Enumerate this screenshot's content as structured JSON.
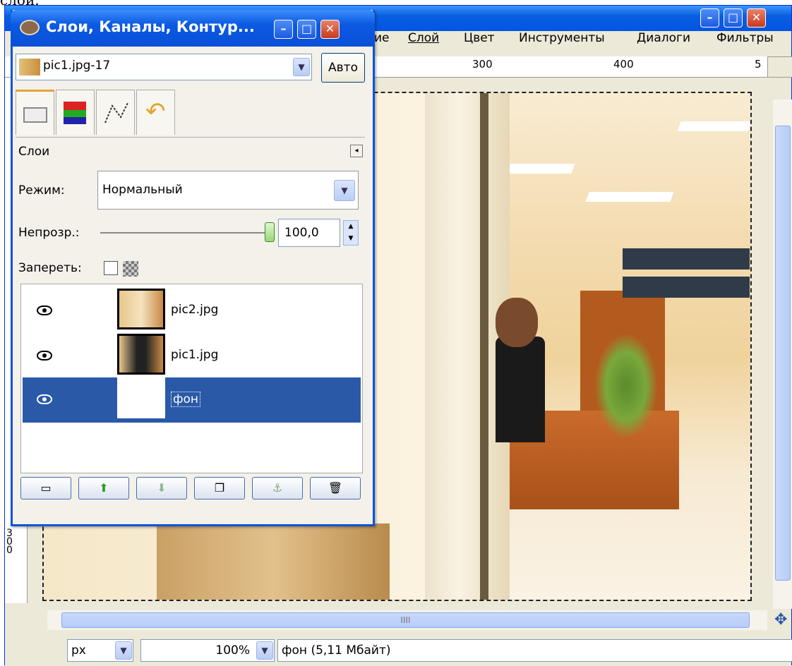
{
  "caption": "слой.",
  "main": {
    "menu": [
      "ие",
      "Слой",
      "Цвет",
      "Инструменты",
      "Диалоги",
      "Фильтры"
    ],
    "ruler_labels": [
      "300",
      "400",
      "5"
    ],
    "left_ruler_label": "300",
    "status": {
      "unit": "px",
      "zoom": "100%",
      "info": "фон (5,11 Мбайт)"
    },
    "scroll_mark": "IIII"
  },
  "dialog": {
    "title": "Слои, Каналы, Контур...",
    "image_selector": "pic1.jpg-17",
    "auto_label": "Авто",
    "tabs": [
      "layers-tab-icon",
      "channels-tab-icon",
      "paths-tab-icon",
      "undo-tab-icon"
    ],
    "panel_title": "Слои",
    "mode_label": "Режим:",
    "mode_value": "Нормальный",
    "opacity_label": "Непрозр.:",
    "opacity_value": "100,0",
    "opacity_fraction": 1.0,
    "lock_label": "Запереть:",
    "layers": [
      {
        "name": "pic2.jpg",
        "visible": true,
        "selected": false
      },
      {
        "name": "pic1.jpg",
        "visible": true,
        "selected": false
      },
      {
        "name": "фон",
        "visible": true,
        "selected": true
      }
    ],
    "buttons": [
      "new-layer-icon",
      "raise-layer-icon",
      "lower-layer-icon",
      "duplicate-layer-icon",
      "anchor-layer-icon",
      "delete-layer-icon"
    ]
  },
  "colors": {
    "selection": "#2a59a8",
    "titlebar": "#0a54d9"
  }
}
